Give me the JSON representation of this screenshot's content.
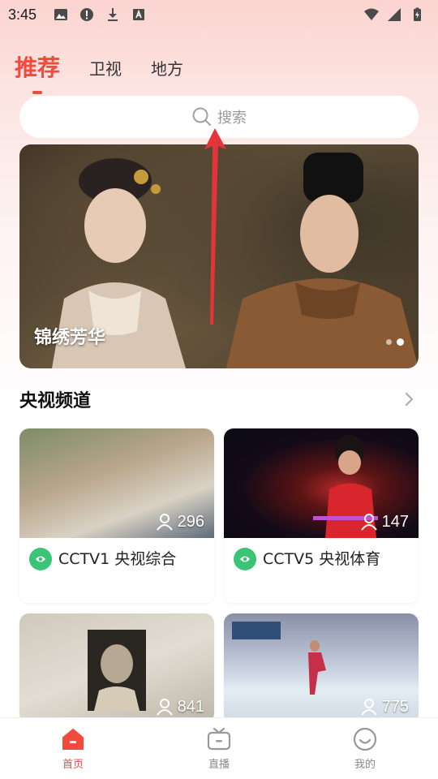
{
  "status_bar": {
    "time": "3:45",
    "icons": [
      "image-icon",
      "alert-icon",
      "download-icon",
      "font-icon"
    ],
    "right_icons": [
      "wifi-icon",
      "signal-icon",
      "battery-charging-icon"
    ]
  },
  "tabs": [
    {
      "label": "推荐",
      "active": true
    },
    {
      "label": "卫视",
      "active": false
    },
    {
      "label": "地方",
      "active": false
    }
  ],
  "search": {
    "placeholder": "搜索",
    "icon": "search-icon"
  },
  "banner": {
    "title": "锦绣芳华",
    "dots": 2,
    "active_dot": 1
  },
  "section": {
    "title": "央视频道",
    "more_icon": "chevron-right-icon"
  },
  "channels": [
    {
      "name": "CCTV1 央视综合",
      "viewers": "296"
    },
    {
      "name": "CCTV5 央视体育",
      "viewers": "147"
    },
    {
      "name": "",
      "viewers": "841"
    },
    {
      "name": "",
      "viewers": "775"
    }
  ],
  "bottom_nav": [
    {
      "label": "首页",
      "icon": "home-icon",
      "active": true
    },
    {
      "label": "直播",
      "icon": "tv-icon",
      "active": false
    },
    {
      "label": "我的",
      "icon": "smiley-icon",
      "active": false
    }
  ],
  "colors": {
    "accent": "#f24a3d",
    "channel_logo": "#3cc476",
    "annotation_arrow": "#e5333a"
  }
}
